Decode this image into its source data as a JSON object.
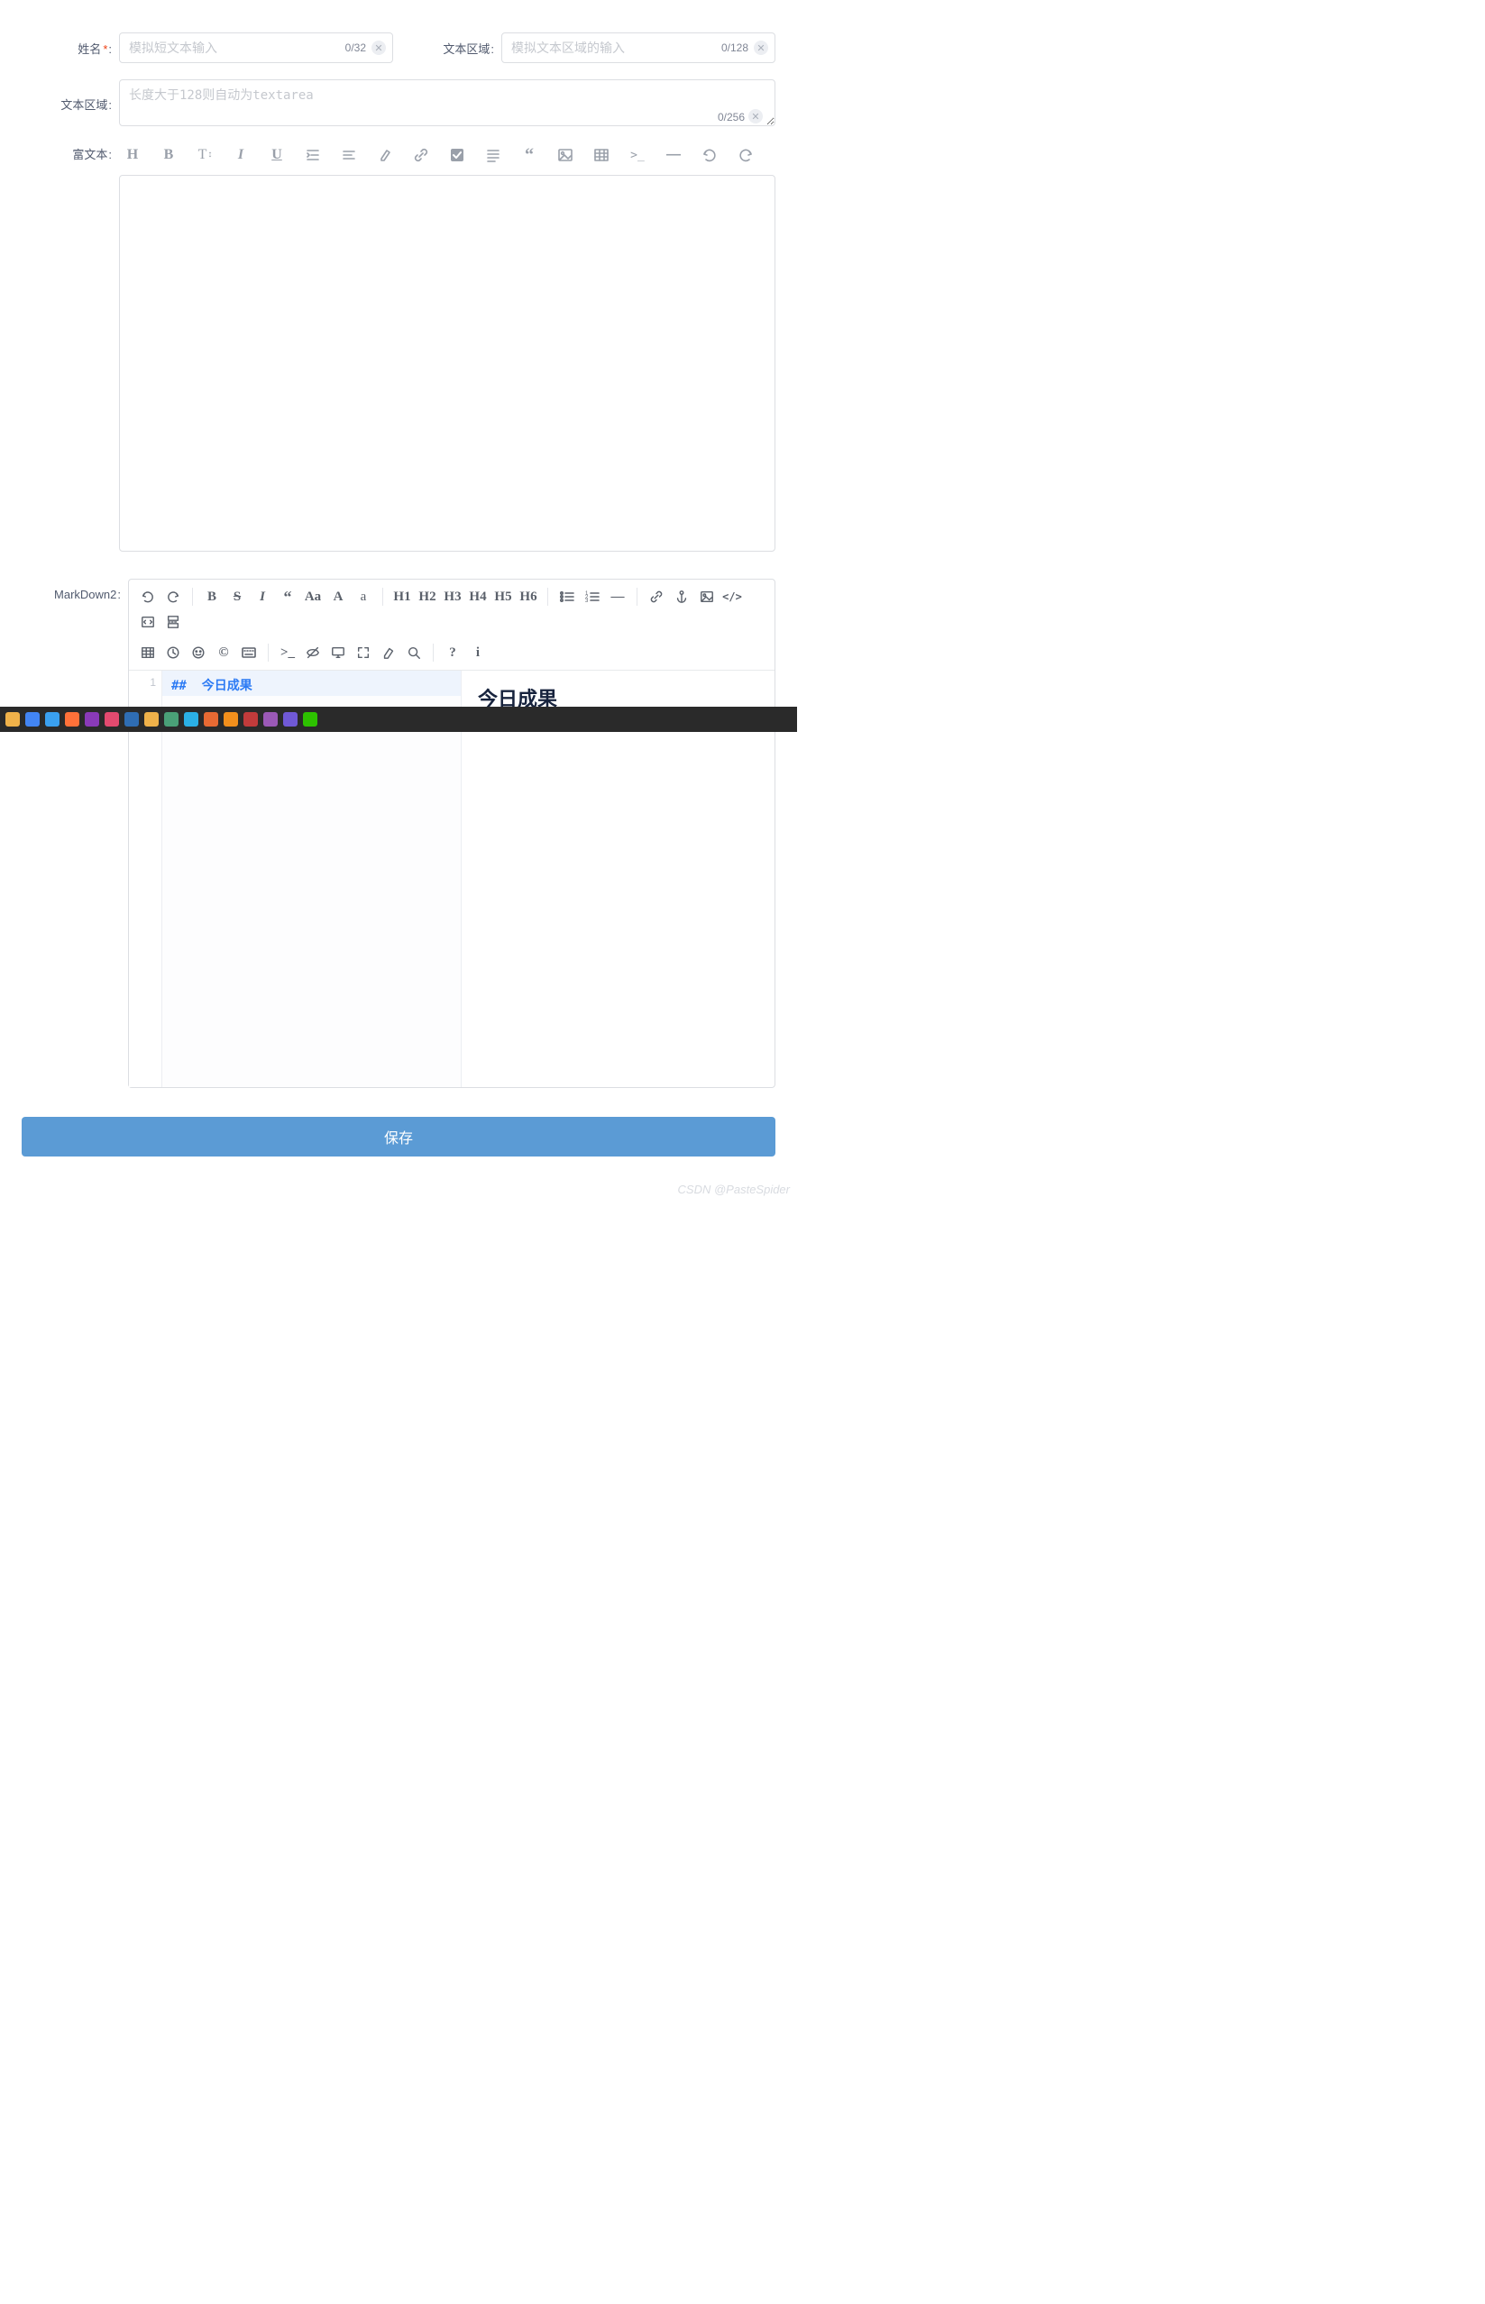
{
  "fields": {
    "name": {
      "label": "姓名",
      "required": true,
      "placeholder": "模拟短文本输入",
      "counter": "0/32"
    },
    "text_area_short": {
      "label": "文本区域",
      "placeholder": "模拟文本区域的输入",
      "counter": "0/128"
    },
    "text_area_long": {
      "label": "文本区域",
      "placeholder": "长度大于128则自动为textarea",
      "counter": "0/256"
    },
    "rich_text": {
      "label": "富文本"
    },
    "markdown": {
      "label": "MarkDown2"
    }
  },
  "rich_toolbar": [
    {
      "name": "heading",
      "glyph": "H"
    },
    {
      "name": "bold",
      "glyph": "B"
    },
    {
      "name": "font-size",
      "glyph": "T"
    },
    {
      "name": "italic",
      "glyph": "I"
    },
    {
      "name": "underline",
      "glyph": "U"
    },
    {
      "name": "indent",
      "glyph": ""
    },
    {
      "name": "align",
      "glyph": ""
    },
    {
      "name": "highlight",
      "glyph": ""
    },
    {
      "name": "link",
      "glyph": ""
    },
    {
      "name": "checkbox",
      "glyph": ""
    },
    {
      "name": "paragraph",
      "glyph": ""
    },
    {
      "name": "quote",
      "glyph": ""
    },
    {
      "name": "image",
      "glyph": ""
    },
    {
      "name": "table",
      "glyph": ""
    },
    {
      "name": "code",
      "glyph": ">_"
    },
    {
      "name": "hr",
      "glyph": "—"
    },
    {
      "name": "undo",
      "glyph": ""
    },
    {
      "name": "redo",
      "glyph": ""
    }
  ],
  "md_toolbar_row1": [
    {
      "name": "undo",
      "label": ""
    },
    {
      "name": "redo",
      "label": ""
    },
    {
      "sep": true
    },
    {
      "name": "bold",
      "label": "B"
    },
    {
      "name": "strike",
      "label": "S"
    },
    {
      "name": "italic",
      "label": "I"
    },
    {
      "name": "quote",
      "label": ""
    },
    {
      "name": "font-size",
      "label": "Aa"
    },
    {
      "name": "font-upper",
      "label": "A"
    },
    {
      "name": "font-lower",
      "label": "a"
    },
    {
      "sep": true
    },
    {
      "name": "h1",
      "label": "H1"
    },
    {
      "name": "h2",
      "label": "H2"
    },
    {
      "name": "h3",
      "label": "H3"
    },
    {
      "name": "h4",
      "label": "H4"
    },
    {
      "name": "h5",
      "label": "H5"
    },
    {
      "name": "h6",
      "label": "H6"
    },
    {
      "sep": true
    },
    {
      "name": "ul",
      "label": ""
    },
    {
      "name": "ol",
      "label": ""
    },
    {
      "name": "hr",
      "label": "—"
    },
    {
      "sep": true
    },
    {
      "name": "link",
      "label": ""
    },
    {
      "name": "anchor",
      "label": ""
    },
    {
      "name": "image",
      "label": ""
    },
    {
      "name": "code",
      "label": "</>"
    },
    {
      "name": "code-block",
      "label": ""
    },
    {
      "name": "page-break",
      "label": ""
    }
  ],
  "md_toolbar_row2": [
    {
      "name": "table",
      "label": ""
    },
    {
      "name": "clock",
      "label": ""
    },
    {
      "name": "emoji",
      "label": ""
    },
    {
      "name": "copyright",
      "label": "©"
    },
    {
      "name": "keyboard",
      "label": ""
    },
    {
      "sep": true
    },
    {
      "name": "terminal",
      "label": ">_"
    },
    {
      "name": "preview-toggle",
      "label": ""
    },
    {
      "name": "monitor",
      "label": ""
    },
    {
      "name": "fullscreen",
      "label": ""
    },
    {
      "name": "eraser",
      "label": ""
    },
    {
      "name": "search",
      "label": ""
    },
    {
      "sep": true
    },
    {
      "name": "help",
      "label": "?"
    },
    {
      "name": "info",
      "label": "i"
    }
  ],
  "markdown_content": {
    "line_no": "1",
    "source_hash": "##",
    "source_text": "今日成果",
    "preview_heading": "今日成果"
  },
  "taskbar_icons": [
    {
      "name": "file-explorer",
      "color": "#f0b24a"
    },
    {
      "name": "chrome",
      "color": "#4285f4"
    },
    {
      "name": "vscode",
      "color": "#3aa0f0"
    },
    {
      "name": "firefox",
      "color": "#ff7139"
    },
    {
      "name": "app-n",
      "color": "#8a3ab9"
    },
    {
      "name": "app-v",
      "color": "#e34a6f"
    },
    {
      "name": "photoshop",
      "color": "#2f6db3"
    },
    {
      "name": "app-yellow",
      "color": "#f0b24a"
    },
    {
      "name": "app-gear",
      "color": "#4aa077"
    },
    {
      "name": "edge",
      "color": "#2bb0e6"
    },
    {
      "name": "app-red",
      "color": "#e86a33"
    },
    {
      "name": "app-orange",
      "color": "#f28f1c"
    },
    {
      "name": "app-w",
      "color": "#c23b3b"
    },
    {
      "name": "app-purple",
      "color": "#9b59b6"
    },
    {
      "name": "app-teal",
      "color": "#7059d6"
    },
    {
      "name": "wechat",
      "color": "#2dc100"
    }
  ],
  "buttons": {
    "save": "保存"
  },
  "watermark": "CSDN @PasteSpider"
}
